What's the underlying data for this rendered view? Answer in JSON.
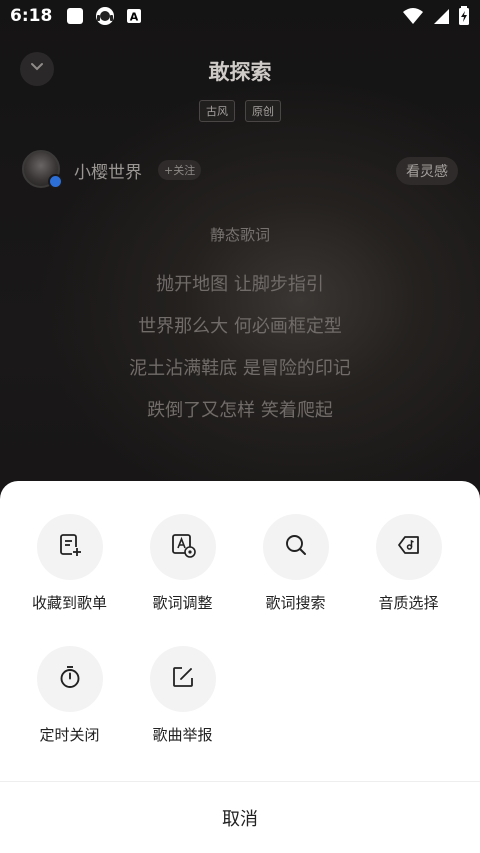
{
  "status_bar": {
    "time": "6:18",
    "icons": [
      "notification-square-icon",
      "headset-app-icon",
      "keyboard-a-icon",
      "wifi-icon",
      "cell-signal-icon",
      "battery-charging-icon"
    ]
  },
  "player": {
    "song_title": "敢探索",
    "tags": [
      "古风",
      "原创"
    ],
    "artist_name": "小樱世界",
    "follow_label": "+关注",
    "inspire_label": "看灵感",
    "lyrics_header": "静态歌词",
    "lyrics": [
      "抛开地图 让脚步指引",
      "世界那么大 何必画框定型",
      "泥土沾满鞋底 是冒险的印记",
      "跌倒了又怎样 笑着爬起"
    ]
  },
  "sheet": {
    "actions": [
      {
        "label": "收藏到歌单",
        "icon": "add-to-playlist-icon"
      },
      {
        "label": "歌词调整",
        "icon": "lyrics-adjust-icon"
      },
      {
        "label": "歌词搜索",
        "icon": "search-icon"
      },
      {
        "label": "音质选择",
        "icon": "audio-quality-icon"
      },
      {
        "label": "定时关闭",
        "icon": "timer-icon"
      },
      {
        "label": "歌曲举报",
        "icon": "report-edit-icon"
      }
    ],
    "cancel_label": "取消"
  },
  "colors": {
    "sheet_bg": "#ffffff",
    "circle_bg": "#f3f3f3",
    "page_bg": "#0e0d0d",
    "badge_blue": "#2c6fd6"
  }
}
